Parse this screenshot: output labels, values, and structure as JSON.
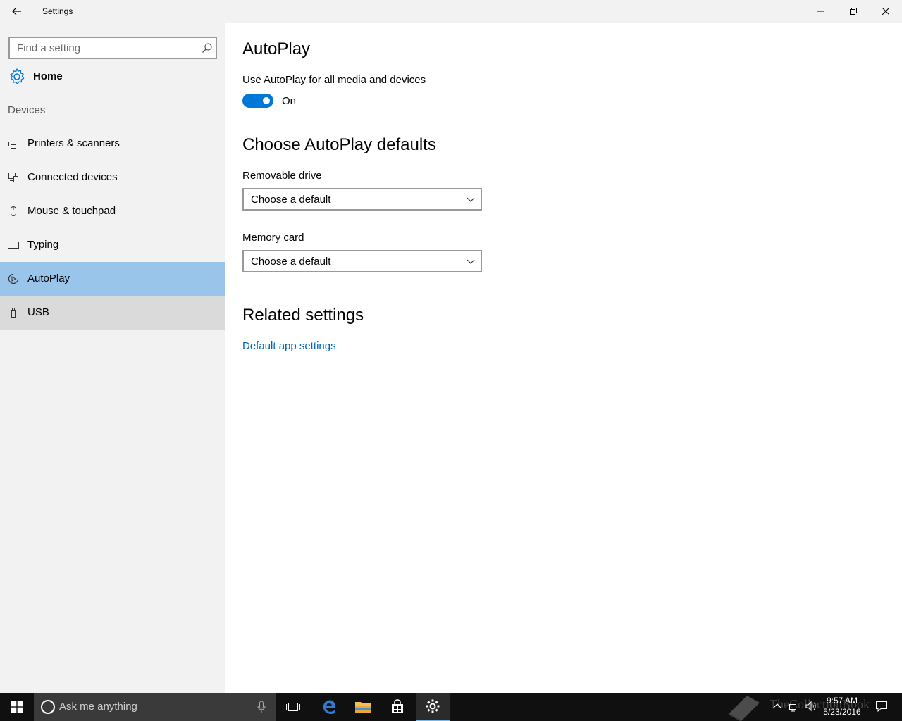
{
  "window": {
    "title": "Settings"
  },
  "sidebar": {
    "search_placeholder": "Find a setting",
    "home_label": "Home",
    "section_label": "Devices",
    "items": [
      {
        "label": "Printers & scanners",
        "icon": "printer-icon"
      },
      {
        "label": "Connected devices",
        "icon": "connected-devices-icon"
      },
      {
        "label": "Mouse & touchpad",
        "icon": "mouse-icon"
      },
      {
        "label": "Typing",
        "icon": "keyboard-icon"
      },
      {
        "label": "AutoPlay",
        "icon": "autoplay-icon",
        "selected": true
      },
      {
        "label": "USB",
        "icon": "usb-icon",
        "hover": true
      }
    ]
  },
  "content": {
    "title": "AutoPlay",
    "toggle_description": "Use AutoPlay for all media and devices",
    "toggle_state": "On",
    "defaults_heading": "Choose AutoPlay defaults",
    "removable_drive": {
      "label": "Removable drive",
      "value": "Choose a default"
    },
    "memory_card": {
      "label": "Memory card",
      "value": "Choose a default"
    },
    "related_heading": "Related settings",
    "related_link": "Default app settings"
  },
  "taskbar": {
    "search_placeholder": "Ask me anything",
    "time": "9:57 AM",
    "date": "5/23/2016",
    "watermark": "TheCollectionBook"
  },
  "colors": {
    "accent": "#0078d7",
    "selected_bg": "#99c5ea",
    "hover_bg": "#dadada",
    "link": "#0066b4"
  }
}
